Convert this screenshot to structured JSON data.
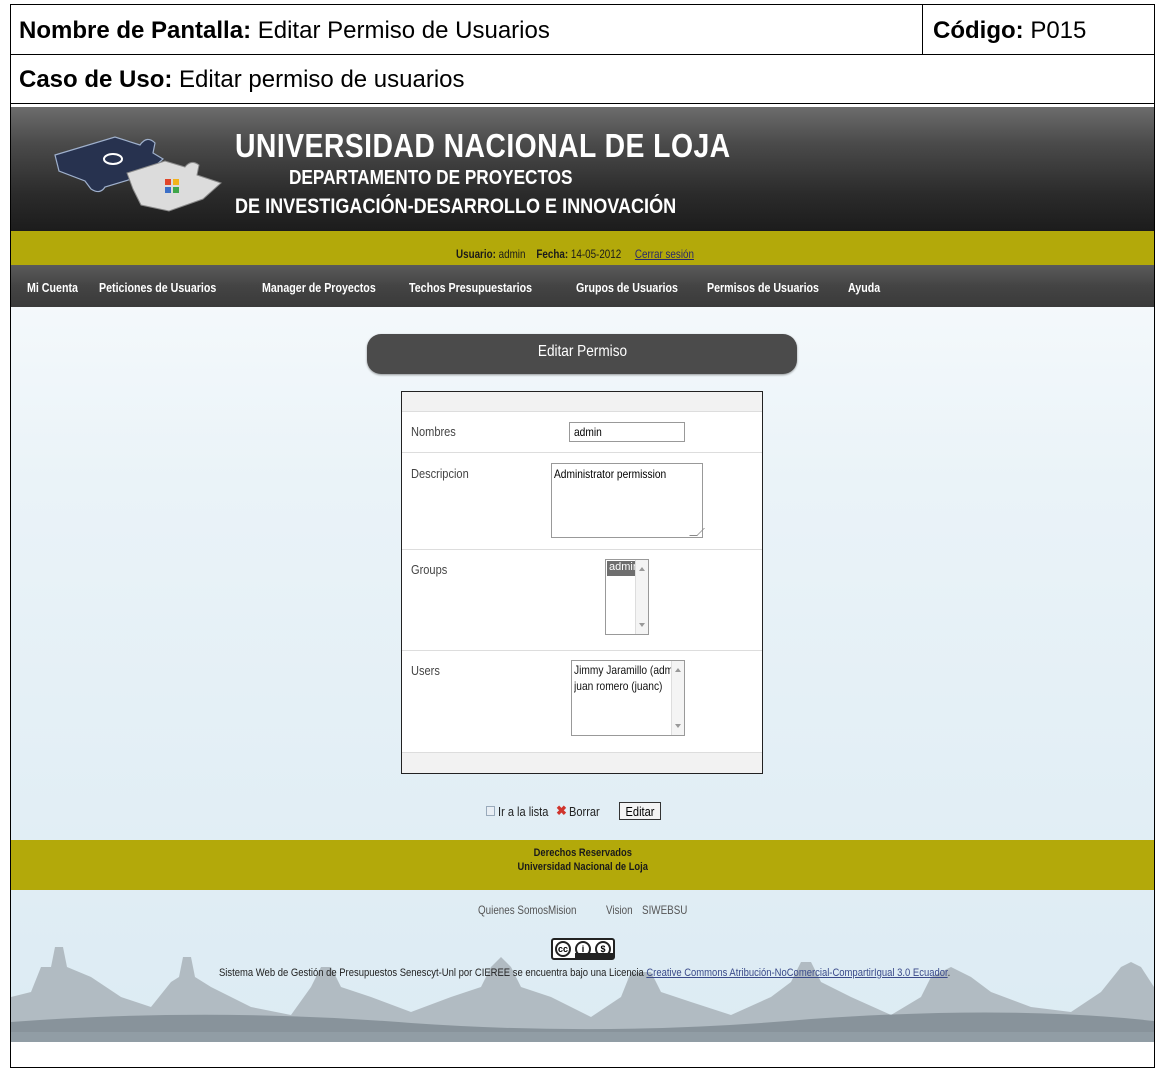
{
  "spec": {
    "screen_name_label": "Nombre de Pantalla:",
    "screen_name_value": "Editar Permiso de Usuarios",
    "code_label": "Código:",
    "code_value": "P015",
    "use_case_label": "Caso de Uso:",
    "use_case_value": "Editar permiso de usuarios"
  },
  "header": {
    "title": "UNIVERSIDAD  NACIONAL  DE  LOJA",
    "subtitle1": "DEPARTAMENTO DE PROYECTOS",
    "subtitle2": "DE INVESTIGACIÓN-DESARROLLO E INNOVACIÓN",
    "logo_icon": "puzzle-logo-icon"
  },
  "userbar": {
    "user_label": "Usuario:",
    "user_value": "admin",
    "date_label": "Fecha:",
    "date_value": "14-05-2012",
    "logout": "Cerrar sesión"
  },
  "nav": {
    "items": [
      "Mi Cuenta",
      "Peticiones de Usuarios",
      "Manager de Proyectos",
      "Techos Presupuestarios",
      "Grupos de Usuarios",
      "Permisos de Usuarios",
      "Ayuda"
    ]
  },
  "form": {
    "title": "Editar Permiso",
    "nombres_label": "Nombres",
    "nombres_value": "admin",
    "descripcion_label": "Descripcion",
    "descripcion_value": "Administrator permission",
    "groups_label": "Groups",
    "groups_options": [
      "admin"
    ],
    "users_label": "Users",
    "users_options": [
      "Jimmy Jaramillo (admin)",
      "juan romero (juanc)"
    ]
  },
  "actions": {
    "list": "Ir a la lista",
    "delete": "Borrar",
    "edit": "Editar"
  },
  "footer": {
    "line1": "Derechos Reservados",
    "line2": "Universidad Nacional de Loja",
    "links": [
      "Quienes Somos",
      "Mision",
      "Vision",
      "SIWEBSU"
    ],
    "license_text": "Sistema Web de Gestión de Presupuestos Senescyt-Unl por CIEREE se encuentra bajo una Licencia",
    "license_link": "Creative Commons Atribución-NoComercial-CompartirIgual 3.0 Ecuador",
    "cc_badge": "cc-by-nc-sa-icon"
  },
  "colors": {
    "olive_bar": "#b3a90a",
    "header_dark": "#2b2b2b",
    "nav_bg": "#444444",
    "form_header_bg": "#4b4b4b",
    "delete_red": "#d0342c"
  }
}
